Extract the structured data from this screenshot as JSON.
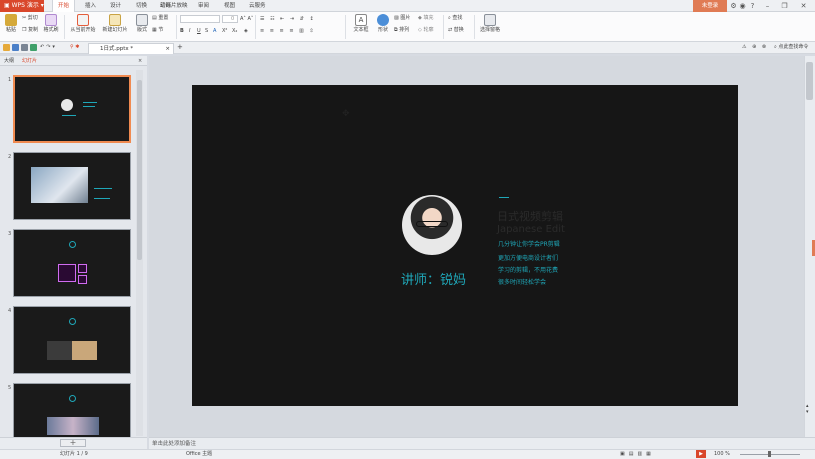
{
  "app": {
    "name": "WPS 演示"
  },
  "menu": {
    "tabs": [
      "开始",
      "插入",
      "设计",
      "切换",
      "动画",
      "幻灯片放映",
      "审阅",
      "视图",
      "云服务"
    ],
    "login": "未登录"
  },
  "ribbon": {
    "cut": "剪切",
    "copy": "复制",
    "paste": "粘贴",
    "format_painter": "格式刷",
    "from_start": "从当前开始",
    "new_slide": "新建幻灯片",
    "layout": "版式",
    "section": "节",
    "reset": "重置",
    "textbox": "文本框",
    "shape": "形状",
    "arrange": "排列",
    "picture": "图片",
    "fill": "填充",
    "outline": "轮廓",
    "find": "查找",
    "replace": "替换",
    "select_pane": "选择窗格",
    "font_size": "0"
  },
  "doc_tab": {
    "name": "1日式.pptx *"
  },
  "search": {
    "placeholder": "点此查找命令"
  },
  "panel": {
    "outline_tab": "大纲",
    "slides_tab": "幻灯片"
  },
  "thumbs": [
    {
      "num": "1"
    },
    {
      "num": "2"
    },
    {
      "num": "3"
    },
    {
      "num": "4"
    },
    {
      "num": "5"
    }
  ],
  "slide": {
    "lecturer": "讲师：锐妈",
    "title_ghost": "日式视频剪辑",
    "subtitle_ghost": "Japanese Edit",
    "tagline": "几分钟让你学会PR剪辑",
    "body": [
      "更加方便电商设计者们",
      "学习的剪辑，不用花费",
      "很多时间轻松学会"
    ]
  },
  "notes": {
    "placeholder": "单击此处添加备注"
  },
  "status": {
    "slide_count": "幻灯片 1 / 9",
    "theme": "Office 主题",
    "zoom": "100 %"
  },
  "colors": {
    "accent": "#d9472b",
    "teal": "#1fa7b8",
    "slide_bg": "#161616"
  }
}
